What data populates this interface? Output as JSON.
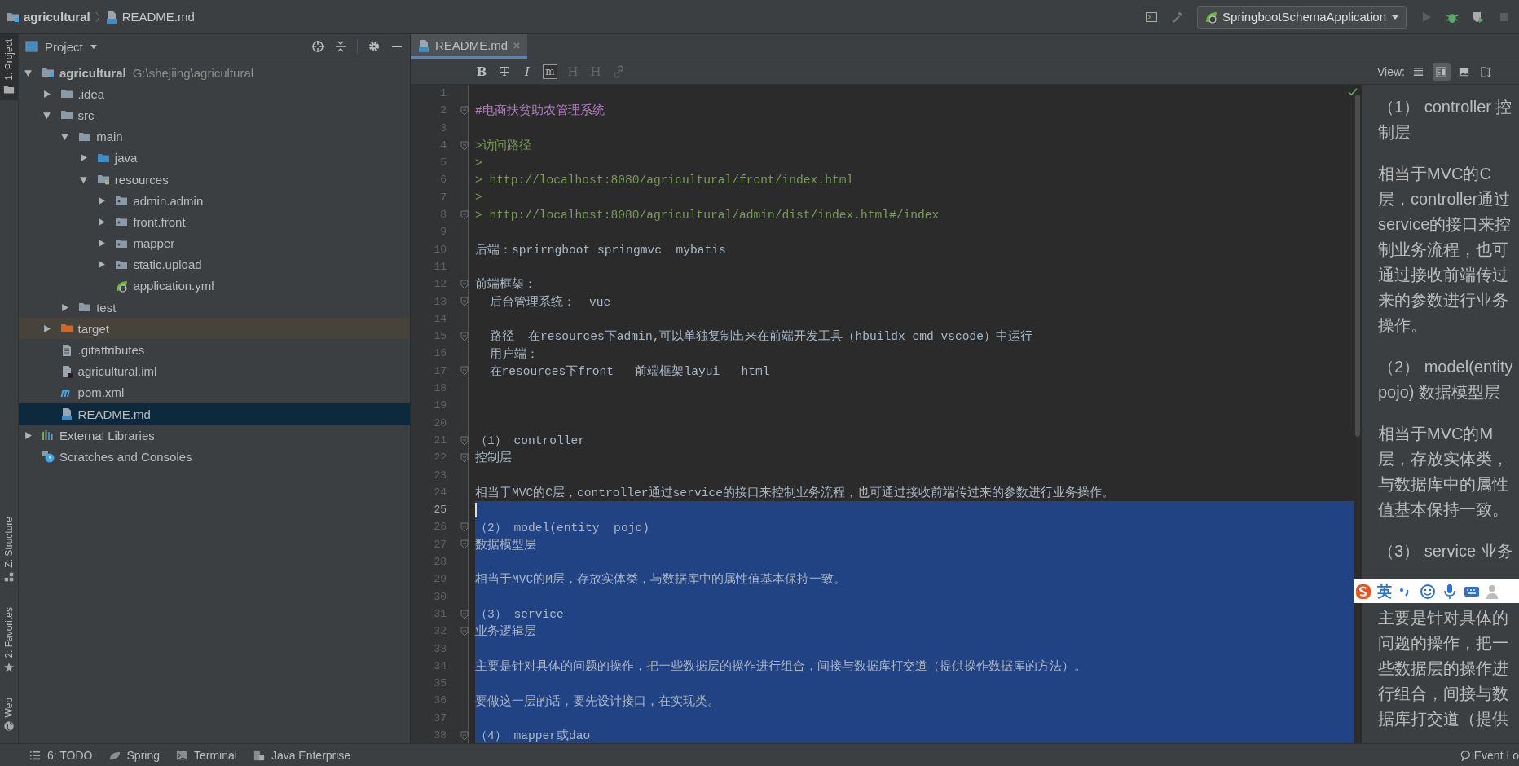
{
  "navbar": {
    "breadcrumb": [
      "agricultural",
      "README.md"
    ],
    "run_config": "SpringbootSchemaApplication"
  },
  "left_strip": [
    {
      "label": "1: Project",
      "selected": true,
      "kind": "folder"
    },
    {
      "label": "Z: Structure",
      "selected": false,
      "kind": "structure"
    },
    {
      "label": "2: Favorites",
      "selected": false,
      "kind": "star"
    },
    {
      "label": "Web",
      "selected": false,
      "kind": "globe"
    }
  ],
  "project": {
    "title": "Project",
    "tree": [
      {
        "name": "agricultural",
        "path": "G:\\shejiing\\agricultural",
        "kind": "project",
        "expanded": true,
        "selected": false,
        "children": [
          {
            "name": ".idea",
            "kind": "folder",
            "expanded": false,
            "selected": false
          },
          {
            "name": "src",
            "kind": "folder",
            "expanded": true,
            "selected": false,
            "children": [
              {
                "name": "main",
                "kind": "folder",
                "expanded": true,
                "selected": false,
                "children": [
                  {
                    "name": "java",
                    "kind": "source",
                    "expanded": false,
                    "selected": false
                  },
                  {
                    "name": "resources",
                    "kind": "resources",
                    "expanded": true,
                    "selected": false,
                    "children": [
                      {
                        "name": "admin.admin",
                        "kind": "package",
                        "expanded": false,
                        "selected": false
                      },
                      {
                        "name": "front.front",
                        "kind": "package",
                        "expanded": false,
                        "selected": false
                      },
                      {
                        "name": "mapper",
                        "kind": "package",
                        "expanded": false,
                        "selected": false
                      },
                      {
                        "name": "static.upload",
                        "kind": "package",
                        "expanded": false,
                        "selected": false
                      },
                      {
                        "name": "application.yml",
                        "kind": "spring",
                        "selected": false
                      }
                    ]
                  }
                ]
              },
              {
                "name": "test",
                "kind": "folder",
                "expanded": false,
                "selected": false
              }
            ]
          },
          {
            "name": "target",
            "kind": "excluded",
            "expanded": false,
            "selected": false
          },
          {
            "name": ".gitattributes",
            "kind": "text",
            "selected": false
          },
          {
            "name": "agricultural.iml",
            "kind": "module",
            "selected": false
          },
          {
            "name": "pom.xml",
            "kind": "maven",
            "selected": false
          },
          {
            "name": "README.md",
            "kind": "markdown",
            "selected": true
          }
        ]
      },
      {
        "name": "External Libraries",
        "kind": "libraries",
        "expanded": false,
        "selected": false
      },
      {
        "name": "Scratches and Consoles",
        "kind": "scratches",
        "selected": false
      }
    ]
  },
  "editor": {
    "tabs": [
      {
        "label": "README.md",
        "selected": true
      }
    ],
    "md_toolbar": [
      {
        "glyph": "B",
        "kind": "bold",
        "disabled": false
      },
      {
        "glyph": "T",
        "kind": "strike",
        "disabled": false
      },
      {
        "glyph": "I",
        "kind": "italic",
        "disabled": false
      },
      {
        "glyph": "m",
        "kind": "code",
        "disabled": false
      },
      {
        "glyph": "H",
        "kind": "header-down",
        "disabled": true
      },
      {
        "glyph": "H",
        "kind": "header-up",
        "disabled": true
      },
      {
        "kind": "link",
        "disabled": true
      }
    ],
    "lines": [
      {
        "n": "1",
        "fold": false,
        "selected": false,
        "current": false
      },
      {
        "n": "2",
        "text": "#电商扶贫助农管理系统",
        "kind": "heading",
        "fold": true,
        "selected": false,
        "current": false
      },
      {
        "n": "3",
        "fold": false,
        "selected": false,
        "current": false
      },
      {
        "n": "4",
        "text": ">访问路径",
        "kind": "quote",
        "fold": true,
        "selected": false,
        "current": false
      },
      {
        "n": "5",
        "text": ">",
        "kind": "quote",
        "fold": false,
        "selected": false,
        "current": false
      },
      {
        "n": "6",
        "text": "> http://localhost:8080/agricultural/front/index.html",
        "kind": "quote",
        "fold": false,
        "selected": false,
        "current": false
      },
      {
        "n": "7",
        "text": ">",
        "kind": "quote",
        "fold": false,
        "selected": false,
        "current": false
      },
      {
        "n": "8",
        "text": "> http://localhost:8080/agricultural/admin/dist/index.html#/index",
        "kind": "quote",
        "fold": true,
        "selected": false,
        "current": false
      },
      {
        "n": "9",
        "fold": false,
        "selected": false,
        "current": false
      },
      {
        "n": "10",
        "text": "后端：sprirngboot springmvc  mybatis",
        "kind": "text",
        "fold": false,
        "selected": false,
        "current": false
      },
      {
        "n": "11",
        "fold": false,
        "selected": false,
        "current": false
      },
      {
        "n": "12",
        "text": "前端框架：",
        "kind": "text",
        "fold": true,
        "selected": false,
        "current": false
      },
      {
        "n": "13",
        "text": "  后台管理系统：  vue",
        "kind": "text",
        "fold": true,
        "selected": false,
        "current": false
      },
      {
        "n": "14",
        "fold": false,
        "selected": false,
        "current": false
      },
      {
        "n": "15",
        "text": "  路径  在resources下admin,可以单独复制出来在前端开发工具（hbuildx cmd vscode）中运行",
        "kind": "text",
        "fold": true,
        "selected": false,
        "current": false
      },
      {
        "n": "16",
        "text": "  用户端：",
        "kind": "text",
        "fold": false,
        "selected": false,
        "current": false
      },
      {
        "n": "17",
        "text": "  在resources下front   前端框架layui   html",
        "kind": "text",
        "fold": true,
        "selected": false,
        "current": false
      },
      {
        "n": "18",
        "fold": false,
        "selected": false,
        "current": false
      },
      {
        "n": "19",
        "fold": false,
        "selected": false,
        "current": false
      },
      {
        "n": "20",
        "fold": false,
        "selected": false,
        "current": false
      },
      {
        "n": "21",
        "text": "（1） controller",
        "kind": "text",
        "fold": true,
        "selected": false,
        "current": false
      },
      {
        "n": "22",
        "text": "控制层",
        "kind": "text",
        "fold": true,
        "selected": false,
        "current": false
      },
      {
        "n": "23",
        "fold": false,
        "selected": false,
        "current": false
      },
      {
        "n": "24",
        "text": "相当于MVC的C层，controller通过service的接口来控制业务流程，也可通过接收前端传过来的参数进行业务操作。",
        "kind": "text",
        "fold": false,
        "selected": false,
        "current": false
      },
      {
        "n": "25",
        "fold": false,
        "selected": true,
        "current": true
      },
      {
        "n": "26",
        "text": "（2） model(entity  pojo)",
        "kind": "text",
        "fold": true,
        "selected": true,
        "current": false
      },
      {
        "n": "27",
        "text": "数据模型层",
        "kind": "text",
        "fold": true,
        "selected": true,
        "current": false
      },
      {
        "n": "28",
        "fold": false,
        "selected": true,
        "current": false
      },
      {
        "n": "29",
        "text": "相当于MVC的M层，存放实体类，与数据库中的属性值基本保持一致。",
        "kind": "text",
        "fold": false,
        "selected": true,
        "current": false
      },
      {
        "n": "30",
        "fold": false,
        "selected": true,
        "current": false
      },
      {
        "n": "31",
        "text": "（3） service",
        "kind": "text",
        "fold": true,
        "selected": true,
        "current": false
      },
      {
        "n": "32",
        "text": "业务逻辑层",
        "kind": "text",
        "fold": true,
        "selected": true,
        "current": false
      },
      {
        "n": "33",
        "fold": false,
        "selected": true,
        "current": false
      },
      {
        "n": "34",
        "text": "主要是针对具体的问题的操作，把一些数据层的操作进行组合，间接与数据库打交道（提供操作数据库的方法）。",
        "kind": "text",
        "fold": false,
        "selected": true,
        "current": false
      },
      {
        "n": "35",
        "fold": false,
        "selected": true,
        "current": false
      },
      {
        "n": "36",
        "text": "要做这一层的话，要先设计接口，在实现类。",
        "kind": "text",
        "fold": false,
        "selected": true,
        "current": false
      },
      {
        "n": "37",
        "fold": false,
        "selected": true,
        "current": false
      },
      {
        "n": "38",
        "text": "（4） mapper或dao",
        "kind": "text",
        "fold": true,
        "selected": true,
        "current": false
      }
    ]
  },
  "preview": {
    "view_label": "View:",
    "view_modes": [
      {
        "kind": "editor",
        "selected": false
      },
      {
        "kind": "split",
        "selected": true
      },
      {
        "kind": "preview",
        "selected": false
      },
      {
        "kind": "sync",
        "selected": false
      }
    ],
    "blocks": [
      {
        "text": "（1） controller 控制层",
        "covered": false
      },
      {
        "text": "相当于MVC的C层，controller通过service的接口来控制业务流程，也可通过接收前端传过来的参数进行业务操作。",
        "covered": false
      },
      {
        "text": "（2） model(entity pojo) 数据模型层",
        "covered": false
      },
      {
        "text": "相当于MVC的M层，存放实体类，与数据库中的属性值基本保持一致。",
        "covered": false
      },
      {
        "text": "（3） service 业务",
        "covered": true
      },
      {
        "text": "主要是针对具体的问题的操作，把一些数据层的操作进行组合，间接与数据库打交道（提供",
        "covered": false
      }
    ]
  },
  "ime_toolbar": {
    "mode": "英"
  },
  "bottom_bar": [
    {
      "label": "6: TODO",
      "kind": "todo"
    },
    {
      "label": "Spring",
      "kind": "spring"
    },
    {
      "label": "Terminal",
      "kind": "terminal"
    },
    {
      "label": "Java Enterprise",
      "kind": "enterprise"
    }
  ],
  "event_log": "Event Lo"
}
